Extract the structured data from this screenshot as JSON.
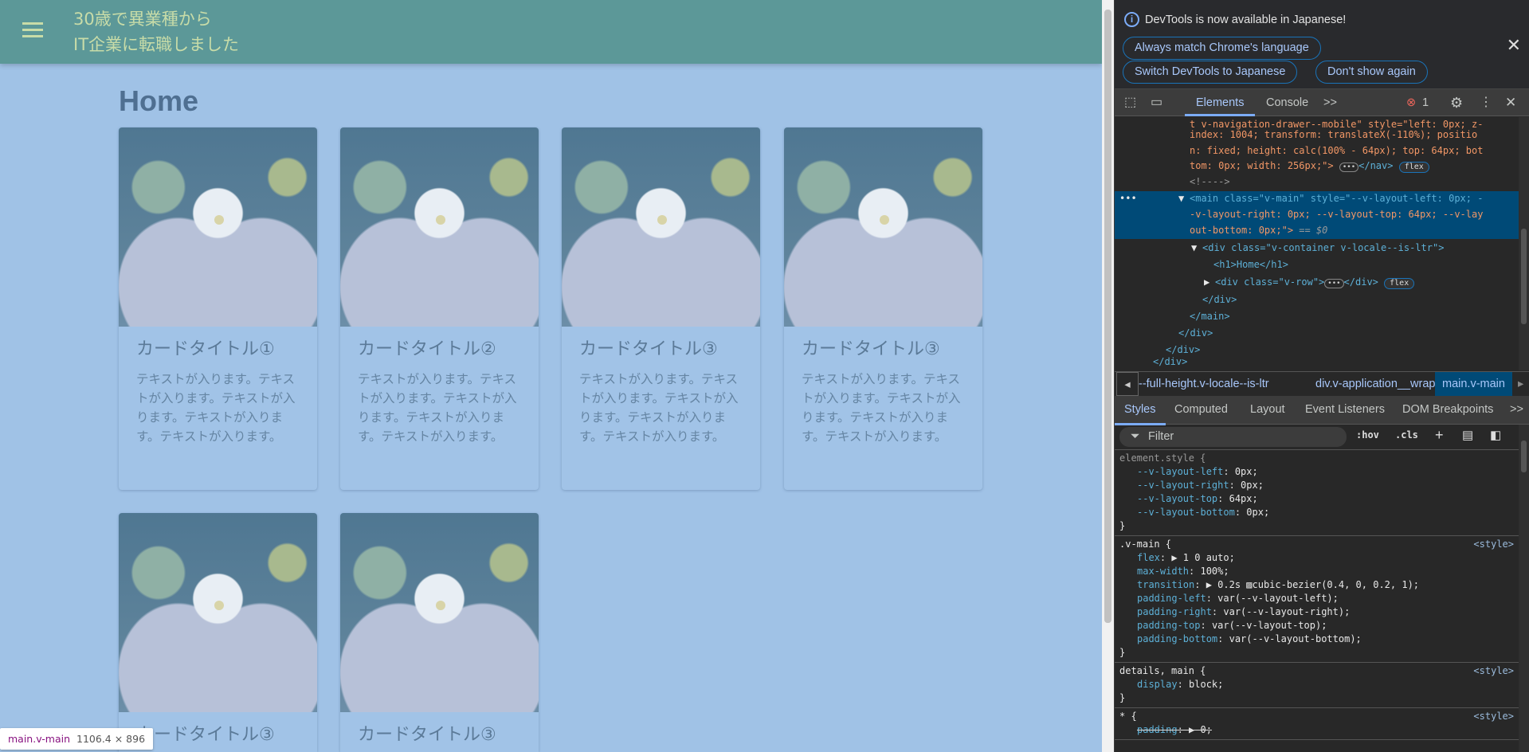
{
  "app": {
    "title_line1": "30歳で異業種から",
    "title_line2": "IT企業に転職しました",
    "heading": "Home",
    "colors": {
      "appbar": "#5c9898",
      "background": "#a0c2e6",
      "title": "#c8dca8"
    }
  },
  "cards": [
    {
      "title": "カードタイトル①",
      "text": "テキストが入ります。テキストが入ります。テキストが入ります。テキストが入ります。テキストが入ります。"
    },
    {
      "title": "カードタイトル②",
      "text": "テキストが入ります。テキストが入ります。テキストが入ります。テキストが入ります。テキストが入ります。"
    },
    {
      "title": "カードタイトル③",
      "text": "テキストが入ります。テキストが入ります。テキストが入ります。テキストが入ります。テキストが入ります。"
    },
    {
      "title": "カードタイトル③",
      "text": "テキストが入ります。テキストが入ります。テキストが入ります。テキストが入ります。テキストが入ります。"
    },
    {
      "title": "カードタイトル③",
      "text": ""
    },
    {
      "title": "カードタイトル③",
      "text": ""
    }
  ],
  "tooltip": {
    "element": "main.v-main",
    "size": "1106.4 × 896"
  },
  "devtools": {
    "banner": {
      "message": "DevTools is now available in Japanese!",
      "btn_match": "Always match Chrome's language",
      "btn_switch": "Switch DevTools to Japanese",
      "btn_dont": "Don't show again"
    },
    "tabs": {
      "elements": "Elements",
      "console": "Console",
      "more": ">>",
      "error_count": "1"
    },
    "tree": [
      "t v-navigation-drawer--mobile\" style=\"left: 0px; z-",
      "index: 1004; transform: translateX(-110%); positio",
      "n: fixed; height: calc(100% - 64px); top: 64px; bot",
      "tom: 0px; width: 256px;\">",
      "<!---->",
      "<main class=\"v-main\" style=\"--v-layout-left: 0px; -",
      "-v-layout-right: 0px; --v-layout-top: 64px; --v-lay",
      "out-bottom: 0px;\">",
      "<div class=\"v-container v-locale--is-ltr\">",
      "<h1>Home</h1>",
      "<div class=\"v-row\">",
      "</div>",
      "</main>",
      "</div>",
      "</div>",
      "</div>"
    ],
    "tree_extra": {
      "nav_close": "</nav>",
      "flex": "flex",
      "eq": "== $0",
      "div_close": "</div>"
    },
    "breadcrumbs": [
      "--full-height.v-locale--is-ltr",
      "div.v-application__wrap",
      "main.v-main"
    ],
    "style_tabs": [
      "Styles",
      "Computed",
      "Layout",
      "Event Listeners",
      "DOM Breakpoints",
      ">>"
    ],
    "filter": {
      "placeholder": "Filter",
      "hov": ":hov",
      "cls": ".cls"
    },
    "rules": [
      {
        "selector": "element.style {",
        "src": "",
        "props": [
          [
            "--v-layout-left",
            "0px;"
          ],
          [
            "--v-layout-right",
            "0px;"
          ],
          [
            "--v-layout-top",
            "64px;"
          ],
          [
            "--v-layout-bottom",
            "0px;"
          ]
        ]
      },
      {
        "selector": ".v-main {",
        "src": "<style>",
        "props": [
          [
            "flex",
            "▶ 1 0 auto;"
          ],
          [
            "max-width",
            "100%;"
          ],
          [
            "transition",
            "▶ 0.2s ▨cubic-bezier(0.4, 0, 0.2, 1);"
          ],
          [
            "padding-left",
            "var(--v-layout-left);"
          ],
          [
            "padding-right",
            "var(--v-layout-right);"
          ],
          [
            "padding-top",
            "var(--v-layout-top);"
          ],
          [
            "padding-bottom",
            "var(--v-layout-bottom);"
          ]
        ]
      },
      {
        "selector": "details, main {",
        "src": "<style>",
        "props": [
          [
            "display",
            "block;"
          ]
        ]
      },
      {
        "selector": "* {",
        "src": "<style>",
        "props": [
          [
            "padding",
            "▶ 0;"
          ]
        ]
      }
    ]
  }
}
